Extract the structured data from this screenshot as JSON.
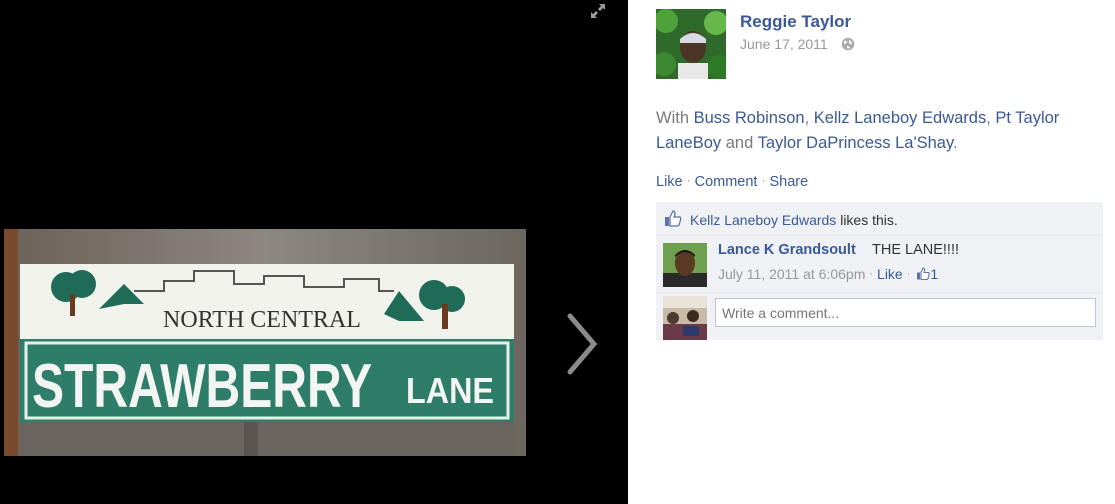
{
  "stage": {
    "sign": {
      "top_text": "NORTH CENTRAL",
      "main_text": "STRAWBERRY",
      "suffix_text": "LANE"
    },
    "expand_icon": "expand-arrows-icon",
    "next_icon": "chevron-right-icon"
  },
  "post": {
    "author": "Reggie Taylor",
    "date": "June 17, 2011",
    "privacy_icon": "globe-icon",
    "with_prefix": "With",
    "tagged": [
      "Buss Robinson",
      "Kellz Laneboy Edwards",
      "Pt Taylor LaneBoy",
      "Taylor DaPrincess La'Shay"
    ],
    "sep1": ",",
    "sep2": ",",
    "and_word": "and",
    "period": ".",
    "actions": {
      "like": "Like",
      "comment": "Comment",
      "share": "Share",
      "dot": "·"
    }
  },
  "ufi": {
    "likes": {
      "name": "Kellz Laneboy Edwards",
      "suffix": "likes this."
    },
    "comment": {
      "author": "Lance K Grandsoult",
      "text": "THE LANE!!!!",
      "time": "July 11, 2011 at 6:06pm",
      "like_label": "Like",
      "like_count": "1",
      "dot": "·"
    },
    "reply": {
      "placeholder": "Write a comment..."
    }
  },
  "colors": {
    "link": "#3b5998",
    "stage_bg": "#000000",
    "ufi_bg": "#eff1f5",
    "sign_green": "#2e7d68"
  }
}
